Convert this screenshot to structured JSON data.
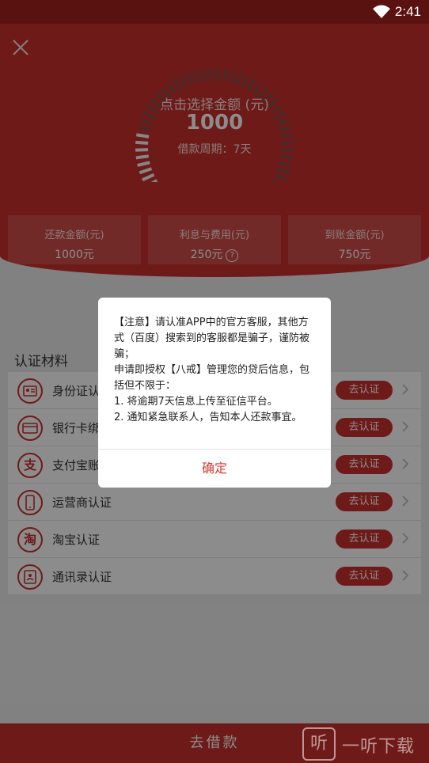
{
  "status_bar": {
    "time": "2:41"
  },
  "hero": {
    "close_icon": "close-icon",
    "amount_title": "点击选择金额 (元)",
    "amount_value": "1000",
    "loan_period": "借款周期：7天"
  },
  "stats": [
    {
      "label": "还款金额(元)",
      "value": "1000元"
    },
    {
      "label": "利息与费用(元)",
      "value": "250元",
      "icon": "question-icon"
    },
    {
      "label": "到账金额(元)",
      "value": "750元"
    }
  ],
  "certification": {
    "title": "认证材料",
    "items": [
      {
        "label": "身份证认证",
        "icon": "id-card-icon",
        "button": "去认证"
      },
      {
        "label": "银行卡绑定",
        "icon": "bank-card-icon",
        "button": "去认证"
      },
      {
        "label": "支付宝账户",
        "icon": "alipay-icon",
        "icon_text": "支",
        "button": "去认证"
      },
      {
        "label": "运营商认证",
        "icon": "phone-icon",
        "button": "去认证"
      },
      {
        "label": "淘宝认证",
        "icon": "taobao-icon",
        "icon_text": "淘",
        "button": "去认证"
      },
      {
        "label": "通讯录认证",
        "icon": "contacts-icon",
        "button": "去认证"
      }
    ]
  },
  "bottom_bar": {
    "label": "去借款"
  },
  "dialog": {
    "line1": "【注意】请认准APP中的官方客服，其他方式（百度）搜索到的客服都是骗子，谨防被骗；",
    "line2": "申请即授权【八戒】管理您的贷后信息，包括但不限于：",
    "line3": "1. 将逾期7天信息上传至征信平台。",
    "line4": "2. 通知紧急联系人，告知本人还款事宜。",
    "confirm": "确定"
  },
  "watermark": {
    "glyph": "听",
    "text": "一听下载"
  },
  "colors": {
    "primary": "#c9302c",
    "status_bar": "#5a1210",
    "confirm_text": "#d73a35"
  }
}
